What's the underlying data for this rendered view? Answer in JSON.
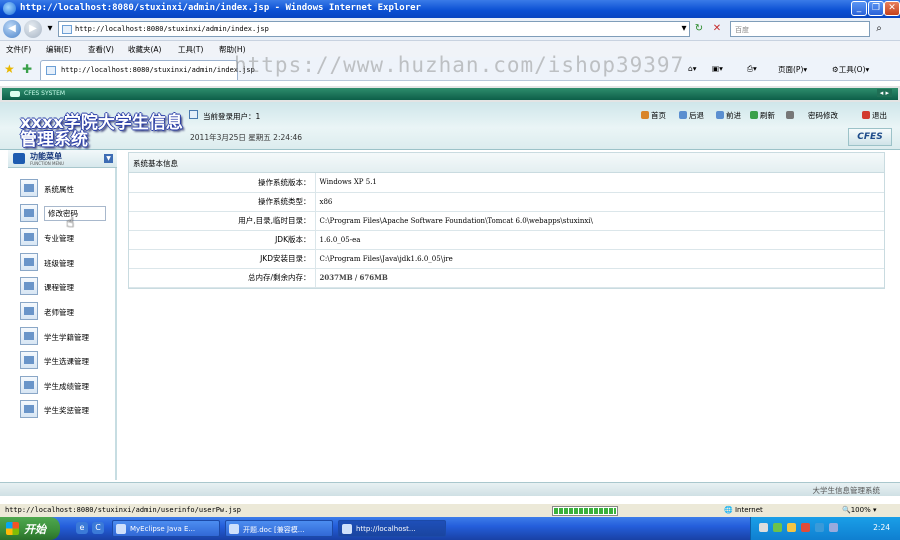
{
  "window": {
    "title": "http://localhost:8080/stuxinxi/admin/index.jsp - Windows Internet Explorer",
    "icon": "ie-icon"
  },
  "browser": {
    "address": "http://localhost:8080/stuxinxi/admin/index.jsp",
    "search_placeholder": "百度",
    "menu": [
      "文件(F)",
      "编辑(E)",
      "查看(V)",
      "收藏夹(A)",
      "工具(T)",
      "帮助(H)"
    ],
    "tab_title": "http://localhost:8080/stuxinxi/admin/index.jsp",
    "watermark": "https://www.huzhan.com/ishop39397",
    "commands": {
      "page": "页面(P)",
      "tools": "工具(O)"
    },
    "status_url": "http://localhost:8080/stuxinxi/admin/userinfo/userPw.jsp",
    "progress": 1.0,
    "zone": "Internet",
    "zoom": "100%"
  },
  "app": {
    "strip_label": "CFES SYSTEM",
    "logo_title": "xxxx学院大学生信息管理系统",
    "current_user_label": "当前登录用户：1",
    "datetime": "2011年3月25日  星期五  2:24:46",
    "topnav": [
      {
        "label": "首页",
        "icon": "home-icon",
        "color": "#d9862a"
      },
      {
        "label": "后退",
        "icon": "back-icon",
        "color": "#5b8fd0"
      },
      {
        "label": "前进",
        "icon": "forward-icon",
        "color": "#5b8fd0"
      },
      {
        "label": "刷新",
        "icon": "refresh-icon",
        "color": "#3aa04a"
      },
      {
        "label": "密码修改",
        "icon": "key-icon",
        "color": "#777777"
      },
      {
        "label": "退出",
        "icon": "exit-icon",
        "color": "#d23b2f"
      }
    ],
    "badge": "CFES",
    "sidebar": {
      "title": "功能菜单",
      "subtitle": "FUNCTION MENU",
      "items": [
        {
          "label": "系统属性"
        },
        {
          "label": "修改密码"
        },
        {
          "label": "专业管理"
        },
        {
          "label": "班级管理"
        },
        {
          "label": "课程管理"
        },
        {
          "label": "老师管理"
        },
        {
          "label": "学生学籍管理"
        },
        {
          "label": "学生选课管理"
        },
        {
          "label": "学生成绩管理"
        },
        {
          "label": "学生奖惩管理"
        }
      ]
    },
    "panel": {
      "title": "系统基本信息",
      "rows": [
        {
          "key": "操作系统版本：",
          "value": "Windows XP  5.1"
        },
        {
          "key": "操作系统类型：",
          "value": "x86"
        },
        {
          "key": "用户,目录,临时目录：",
          "value": "C:\\Program Files\\Apache Software Foundation\\Tomcat 6.0\\webapps\\stuxinxi\\"
        },
        {
          "key": "JDK版本：",
          "value": "1.6.0_05-ea"
        },
        {
          "key": "JKD安装目录：",
          "value": "C:\\Program Files\\Java\\jdk1.6.0_05\\jre"
        },
        {
          "key": "总内存/剩余内存：",
          "total": "2037MB",
          "sep": " / ",
          "free": "676MB"
        }
      ]
    },
    "footer": "大学生信息管理系统"
  },
  "taskbar": {
    "start": "开始",
    "tasks": [
      {
        "label": "MyEclipse Java E..."
      },
      {
        "label": "开题.doc [兼容模..."
      },
      {
        "label": "http://localhost..."
      }
    ],
    "clock": "2:24"
  },
  "colors": {
    "title_blue": "#0a4fd2",
    "app_green": "#0d5f48",
    "header_teal": "#cfe6ea",
    "start_green": "#3a8d3a"
  }
}
